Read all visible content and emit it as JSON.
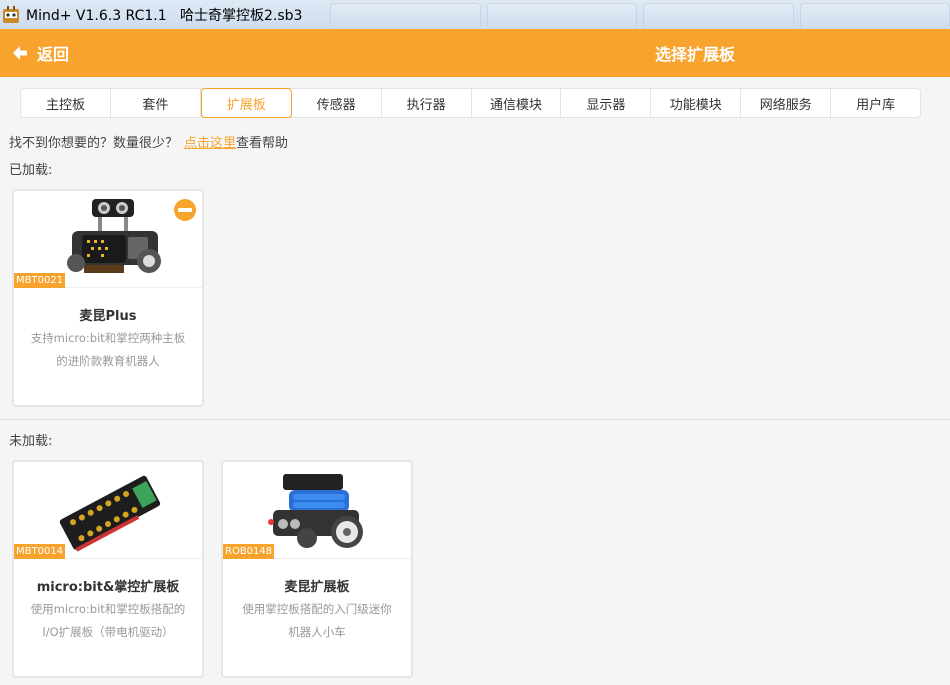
{
  "window": {
    "title": "Mind+ V1.6.3 RC1.1   哈士奇掌控板2.sb3"
  },
  "topbar": {
    "back_label": "返回",
    "heading": "选择扩展板",
    "bg_color": "#f7a32e"
  },
  "tabs": [
    {
      "label": "主控板",
      "active": false
    },
    {
      "label": "套件",
      "active": false
    },
    {
      "label": "扩展板",
      "active": true
    },
    {
      "label": "传感器",
      "active": false
    },
    {
      "label": "执行器",
      "active": false
    },
    {
      "label": "通信模块",
      "active": false
    },
    {
      "label": "显示器",
      "active": false
    },
    {
      "label": "功能模块",
      "active": false
    },
    {
      "label": "网络服务",
      "active": false
    },
    {
      "label": "用户库",
      "active": false
    }
  ],
  "help": {
    "prefix": "找不到你想要的？数量很少？",
    "link": "点击这里",
    "suffix": "查看帮助"
  },
  "loaded": {
    "label": "已加载:",
    "cards": [
      {
        "sku": "MBT0021",
        "name": "麦昆Plus",
        "desc_line1": "支持micro:bit和掌控两种主板",
        "desc_line2": "的进阶款教育机器人",
        "icon": "robot-car-image"
      }
    ]
  },
  "unloaded": {
    "label": "未加载:",
    "cards": [
      {
        "sku": "MBT0014",
        "name": "micro:bit&掌控扩展板",
        "desc_line1": "使用micro:bit和掌控板搭配的",
        "desc_line2": "I/O扩展板（带电机驱动）",
        "icon": "expansion-board-image"
      },
      {
        "sku": "ROB0148",
        "name": "麦昆扩展板",
        "desc_line1": "使用掌控板搭配的入门级迷你",
        "desc_line2": "机器人小车",
        "icon": "mini-robot-car-image"
      }
    ]
  }
}
